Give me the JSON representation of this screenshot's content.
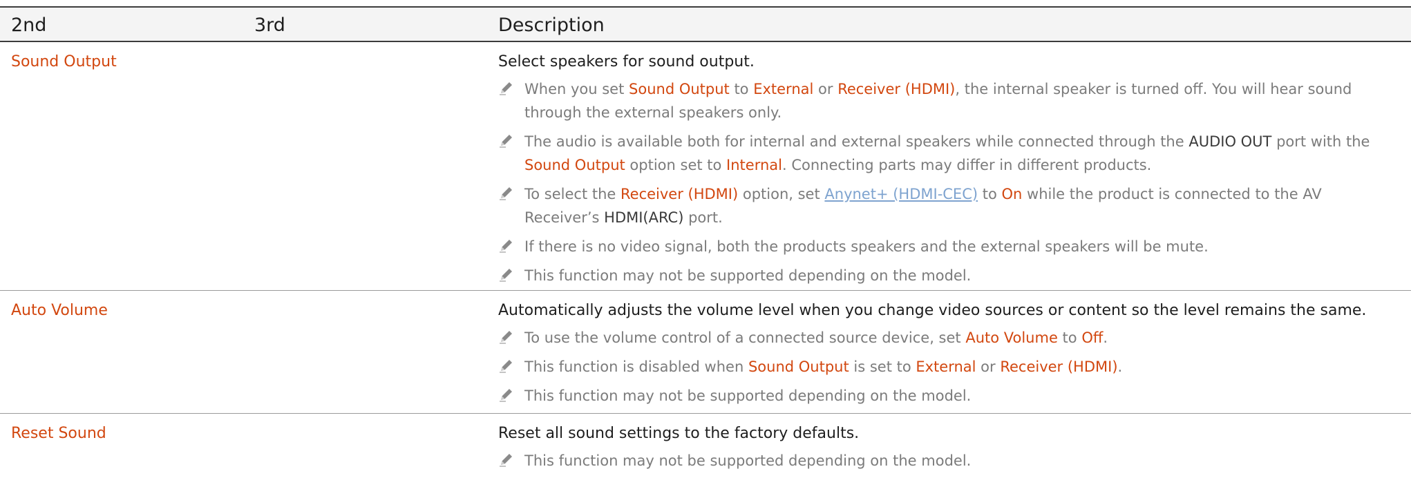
{
  "header": {
    "col_2nd": "2nd",
    "col_3rd": "3rd",
    "col_desc": "Description"
  },
  "rows": [
    {
      "name": "Sound Output",
      "lead": "Select speakers for sound output.",
      "notes": {
        "n1": {
          "a": "When you set ",
          "b": "Sound Output",
          "c": " to ",
          "d": "External",
          "e": " or ",
          "f": "Receiver (HDMI)",
          "g": ", the internal speaker is turned off. You will hear sound through the external speakers only."
        },
        "n2": {
          "a": "The audio is available both for internal and external speakers while connected through the ",
          "b": "AUDIO OUT",
          "c": " port with the ",
          "d": "Sound Output",
          "e": " option set to ",
          "f": "Internal",
          "g": ". Connecting parts may differ in different products."
        },
        "n3": {
          "a": "To select the ",
          "b": "Receiver (HDMI)",
          "c": " option, set ",
          "d": "Anynet+ (HDMI-CEC)",
          "e": " to ",
          "f": "On",
          "g": " while the product is connected to the AV Receiver’s ",
          "h": "HDMI(ARC)",
          "i": " port."
        },
        "n4": "If there is no video signal, both the products speakers and the external speakers will be mute.",
        "n5": "This function may not be supported depending on the model."
      }
    },
    {
      "name": "Auto Volume",
      "lead": "Automatically adjusts the volume level when you change video sources or content so the level remains the same.",
      "notes": {
        "n1": {
          "a": "To use the volume control of a connected source device, set ",
          "b": "Auto Volume",
          "c": " to ",
          "d": "Off",
          "e": "."
        },
        "n2": {
          "a": "This function is disabled when ",
          "b": "Sound Output",
          "c": " is set to ",
          "d": "External",
          "e": " or ",
          "f": "Receiver (HDMI)",
          "g": "."
        },
        "n3": "This function may not be supported depending on the model."
      }
    },
    {
      "name": "Reset Sound",
      "lead": "Reset all sound settings to the factory defaults.",
      "notes": {
        "n1": "This function may not be supported depending on the model."
      }
    }
  ],
  "colors": {
    "highlight": "#d2470f",
    "note_text": "#7b7b7b",
    "link": "#7ea3cf",
    "header_bg": "#f4f4f4"
  },
  "icons": {
    "note": "pencil-icon"
  }
}
